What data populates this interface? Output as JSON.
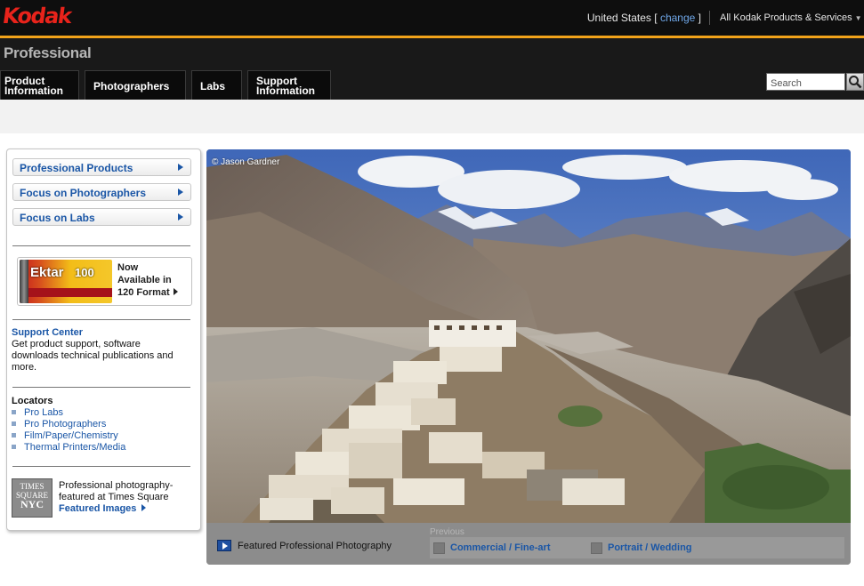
{
  "header": {
    "logo": "Kodak",
    "country": "United States",
    "bracket_open": "[",
    "change_label": "change",
    "bracket_close": "]",
    "all_products": "All Kodak Products & Services",
    "accent_color": "#f0a21a",
    "logo_color": "#e8231b"
  },
  "subheader": {
    "title": "Professional",
    "tabs": [
      {
        "line1": "Product",
        "line2": "Information"
      },
      {
        "line1": "Photographers",
        "line2": ""
      },
      {
        "line1": "Labs",
        "line2": ""
      },
      {
        "line1": "Support",
        "line2": "Information"
      }
    ],
    "search_placeholder": "Search",
    "search_icon": "magnifier-icon"
  },
  "sidebar": {
    "links": [
      {
        "label": "Professional Products",
        "icon": "arrow-right-icon"
      },
      {
        "label": "Focus on Photographers",
        "icon": "arrow-right-icon"
      },
      {
        "label": "Focus on Labs",
        "icon": "arrow-right-icon"
      }
    ],
    "promo": {
      "film_brand": "Ektar",
      "film_number": "100",
      "line1": "Now",
      "line2": "Available in",
      "line3": "120 Format"
    },
    "support": {
      "title": "Support Center",
      "desc": "Get product support, software downloads technical publications and more."
    },
    "locators": {
      "title": "Locators",
      "items": [
        "Pro Labs",
        "Pro Photographers",
        "Film/Paper/Chemistry",
        "Thermal Printers/Media"
      ]
    },
    "times_square": {
      "badge_line1": "TIMES",
      "badge_line2": "SQUARE",
      "badge_line3": "NYC",
      "text_line1": "Professional photography-",
      "text_line2": "featured at Times Square",
      "link": "Featured Images"
    }
  },
  "hero": {
    "credit": "© Jason Gardner",
    "caption": "Featured Professional Photography",
    "previous_label": "Previous",
    "previous_items": [
      "Commercial / Fine-art",
      "Portrait / Wedding"
    ]
  }
}
